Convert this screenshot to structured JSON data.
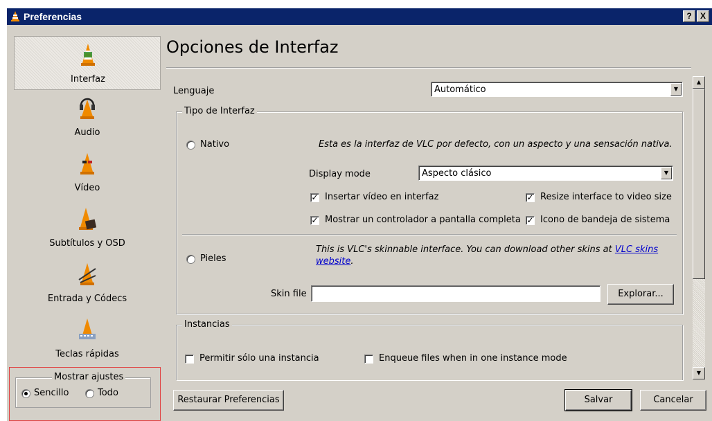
{
  "window": {
    "title": "Preferencias",
    "help_btn": "?",
    "close_btn": "X"
  },
  "sidebar": {
    "items": [
      {
        "label": "Interfaz",
        "icon": "cone-interface-icon",
        "selected": true
      },
      {
        "label": "Audio",
        "icon": "cone-headphones-icon"
      },
      {
        "label": "Vídeo",
        "icon": "cone-glasses-icon"
      },
      {
        "label": "Subtítulos y OSD",
        "icon": "cone-subtitles-icon"
      },
      {
        "label": "Entrada y Códecs",
        "icon": "cone-cables-icon"
      },
      {
        "label": "Teclas rápidas",
        "icon": "cone-keyboard-icon"
      }
    ],
    "show_settings": {
      "legend": "Mostrar ajustes",
      "simple": "Sencillo",
      "all": "Todo",
      "selected": "simple"
    }
  },
  "main": {
    "heading": "Opciones de Interfaz",
    "language_label": "Lenguaje",
    "language_value": "Automático",
    "interface_type": {
      "legend": "Tipo de Interfaz",
      "native_label": "Nativo",
      "native_desc": "Esta es la interfaz de VLC por defecto, con un aspecto y una sensación nativa.",
      "display_mode_label": "Display mode",
      "display_mode_value": "Aspecto clásico",
      "embed_video": {
        "label": "Insertar vídeo en interfaz",
        "checked": true
      },
      "resize_interface": {
        "label": "Resize interface to video size",
        "checked": true
      },
      "fullscreen_controller": {
        "label": "Mostrar un controlador a pantalla completa",
        "checked": true
      },
      "systray_icon": {
        "label": "Icono de bandeja de sistema",
        "checked": true
      },
      "skins_label": "Pieles",
      "skins_desc": "This is VLC's skinnable interface. You can download other skins at",
      "skins_link_1": "VLC skins",
      "skins_link_2": "website",
      "skins_desc_end": ".",
      "skin_file_label": "Skin file",
      "skin_file_value": "",
      "browse_label": "Explorar..."
    },
    "instances": {
      "legend": "Instancias",
      "one_instance": {
        "label": "Permitir sólo una instancia",
        "checked": false
      },
      "enqueue": {
        "label": "Enqueue files when in one instance mode",
        "checked": false
      }
    }
  },
  "footer": {
    "reset_label": "Restaurar Preferencias",
    "save_label": "Salvar",
    "cancel_label": "Cancelar"
  },
  "colors": {
    "titlebar": "#0a246a",
    "dialog_bg": "#d4d0c8",
    "link": "#0000cc",
    "highlight_box": "#e04040"
  }
}
